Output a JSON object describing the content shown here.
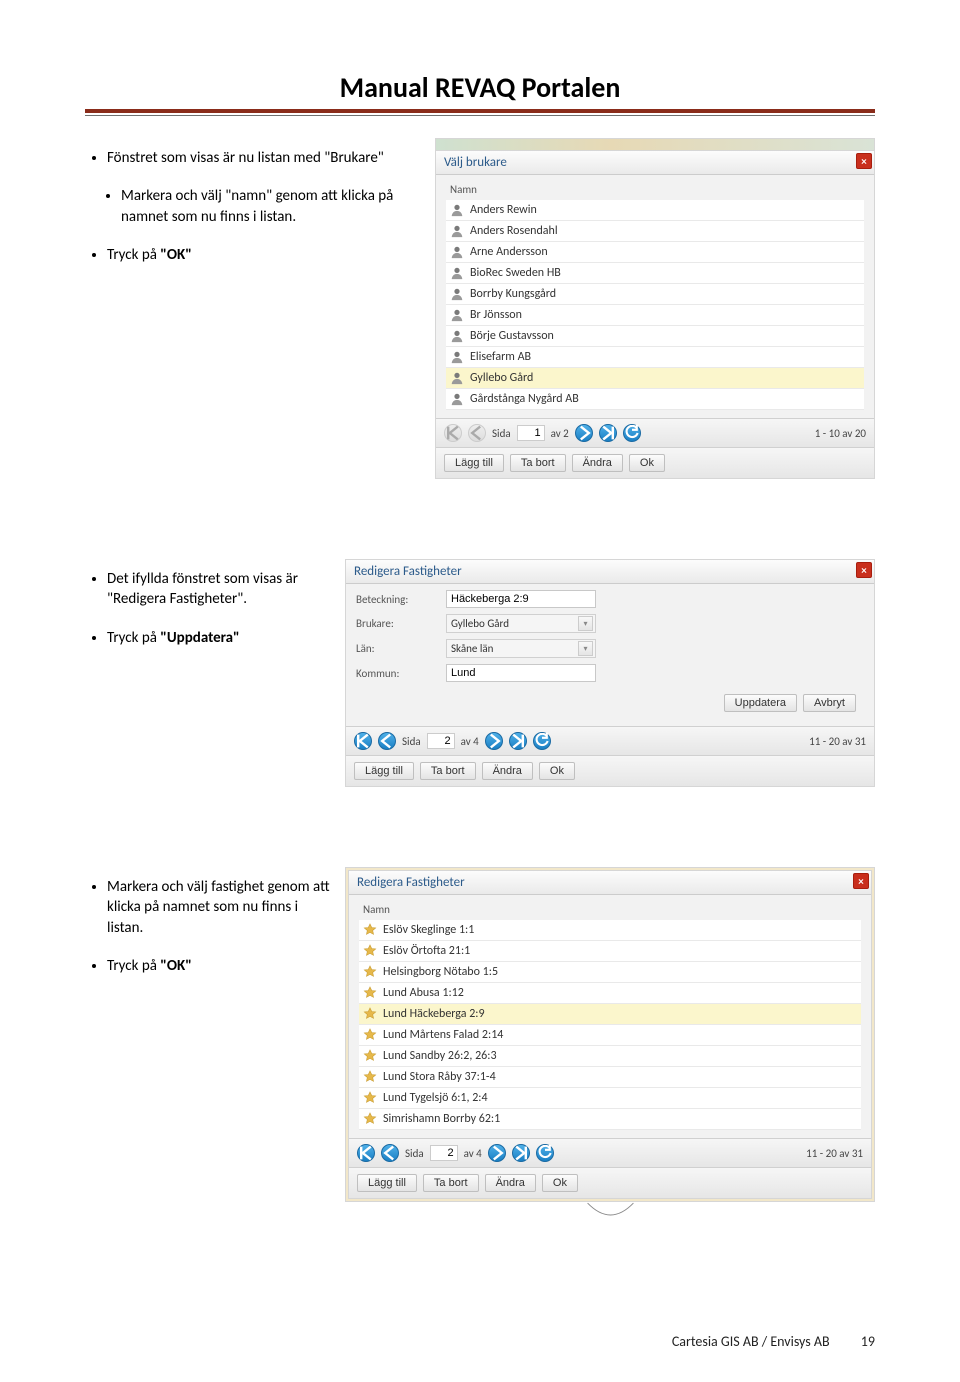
{
  "header": {
    "title": "Manual REVAQ Portalen"
  },
  "section1": {
    "bullets": {
      "b1": "Fönstret som visas är nu listan med \"Brukare\"",
      "b2": "Markera och välj \"namn\" genom att klicka på namnet som nu finns i listan.",
      "b3_pre": "Tryck på ",
      "b3_quote": "\"OK\""
    },
    "panel": {
      "title": "Välj brukare",
      "namn_header": "Namn",
      "items": [
        "Anders Rewin",
        "Anders Rosendahl",
        "Arne Andersson",
        "BioRec Sweden HB",
        "Borrby Kungsgård",
        "Br Jönsson",
        "Börje Gustavsson",
        "Elisefarm AB",
        "Gyllebo Gård",
        "Gårdstånga Nygård AB"
      ],
      "selected_index": 8,
      "pager": {
        "label_sida": "Sida",
        "page": "1",
        "label_av": "av 2",
        "info": "1 - 10 av 20"
      },
      "buttons": {
        "add": "Lägg till",
        "remove": "Ta bort",
        "edit": "Ändra",
        "ok": "Ok"
      }
    }
  },
  "section2": {
    "bullets": {
      "b1_pre": "Det ifyllda fönstret som visas är ",
      "b1_quote": "\"Redigera Fastigheter\".",
      "b2_pre": "Tryck på ",
      "b2_quote": "\"Uppdatera\""
    },
    "panel": {
      "title": "Redigera Fastigheter",
      "labels": {
        "beteckning": "Beteckning:",
        "brukare": "Brukare:",
        "lan": "Län:",
        "kommun": "Kommun:"
      },
      "values": {
        "beteckning": "Häckeberga 2:9",
        "brukare": "Gyllebo Gård",
        "lan": "Skåne län",
        "kommun": "Lund"
      },
      "buttons": {
        "update": "Uppdatera",
        "cancel": "Avbryt"
      },
      "pager": {
        "label_sida": "Sida",
        "page": "2",
        "label_av": "av 4",
        "info": "11 - 20 av 31"
      },
      "buttons2": {
        "add": "Lägg till",
        "remove": "Ta bort",
        "edit": "Ändra",
        "ok": "Ok"
      }
    }
  },
  "section3": {
    "bullets": {
      "b1": "Markera och välj  fastighet genom att klicka på namnet som nu finns i listan.",
      "b2_pre": "Tryck på ",
      "b2_quote": "\"OK\""
    },
    "panel": {
      "title": "Redigera Fastigheter",
      "namn_header": "Namn",
      "items": [
        "Eslöv Skeglinge 1:1",
        "Eslöv Örtofta 21:1",
        "Helsingborg Nötabo 1:5",
        "Lund Abusa 1:12",
        "Lund Häckeberga 2:9",
        "Lund Mårtens Falad 2:14",
        "Lund Sandby 26:2, 26:3",
        "Lund Stora Råby 37:1-4",
        "Lund Tygelsjö 6:1, 2:4",
        "Simrishamn Borrby 62:1"
      ],
      "selected_index": 4,
      "pager": {
        "label_sida": "Sida",
        "page": "2",
        "label_av": "av 4",
        "info": "11 - 20 av 31"
      },
      "buttons": {
        "add": "Lägg till",
        "remove": "Ta bort",
        "edit": "Ändra",
        "ok": "Ok"
      }
    }
  },
  "footer": {
    "text": "Cartesia GIS AB  / Envisys AB",
    "page": "19"
  }
}
